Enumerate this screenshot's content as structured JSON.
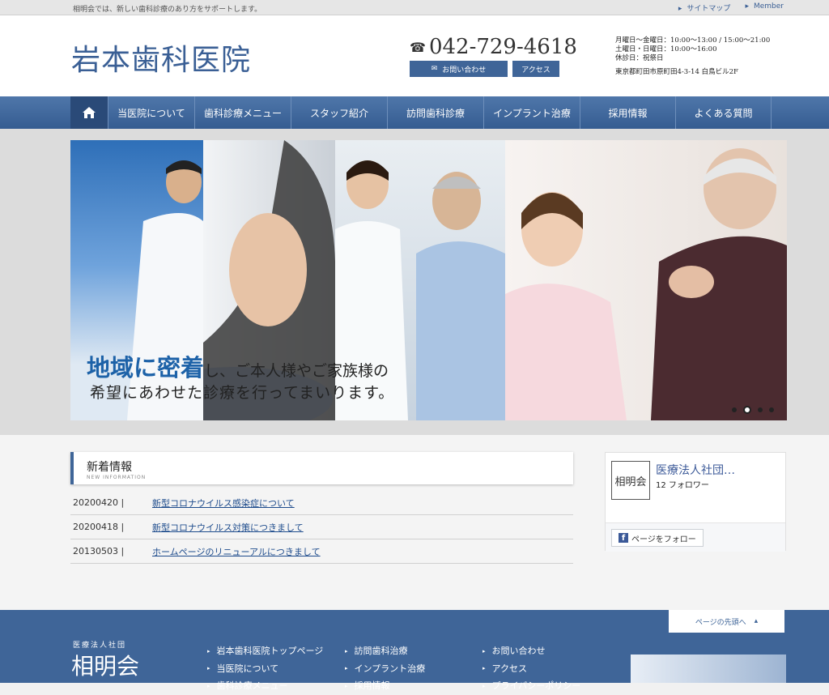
{
  "topbar": {
    "tagline": "相明会では、新しい歯科診療のあり方をサポートします。",
    "links": [
      "サイトマップ",
      "Member"
    ]
  },
  "header": {
    "logo": "岩本歯科医院",
    "phone": "042-729-4618",
    "contact_label": "お問い合わせ",
    "access_label": "アクセス",
    "hours": [
      "月曜日～金曜日：10:00～13:00 / 15:00～21:00",
      "土曜日・日曜日：10:00～16:00",
      "休診日：祝祭日"
    ],
    "address": "東京都町田市原町田4-3-14 白鳥ビル2F"
  },
  "nav": {
    "home_icon": "home-icon",
    "items": [
      "当医院について",
      "歯科診療メニュー",
      "スタッフ紹介",
      "訪問歯科診療",
      "インプラント治療",
      "採用情報",
      "よくある質問"
    ]
  },
  "hero": {
    "highlight": "地域に密着",
    "line1_rest": "し、ご本人様やご家族様の",
    "line2": "希望にあわせた診療を行ってまいります。",
    "slide_count": 4,
    "active_slide": 2
  },
  "news": {
    "title": "新着情報",
    "subtitle": "NEW INFORMATION",
    "items": [
      {
        "date": "20200420 |",
        "text": "新型コロナウイルス感染症について"
      },
      {
        "date": "20200418 |",
        "text": "新型コロナウイルス対策につきまして"
      },
      {
        "date": "20130503 |",
        "text": "ホームページのリニューアルにつきまして"
      }
    ]
  },
  "facebook": {
    "avatar_text": "相明会",
    "name": "医療法人社団…",
    "followers": "12 フォロワー",
    "follow_label": "ページをフォロー"
  },
  "footer": {
    "pagetop": "ページの先頭へ",
    "brand_sub": "医療法人社団",
    "brand": "相明会",
    "col1": [
      "岩本歯科医院トップページ",
      "当医院について",
      "歯科診療メニュー"
    ],
    "col2": [
      "訪問歯科治療",
      "インプラント治療",
      "採用情報"
    ],
    "col3": [
      "お問い合わせ",
      "アクセス",
      "プライバシーポリシー"
    ]
  },
  "colors": {
    "primary": "#3f6598",
    "nav": "#4f77aa",
    "highlight": "#1d62a8"
  }
}
